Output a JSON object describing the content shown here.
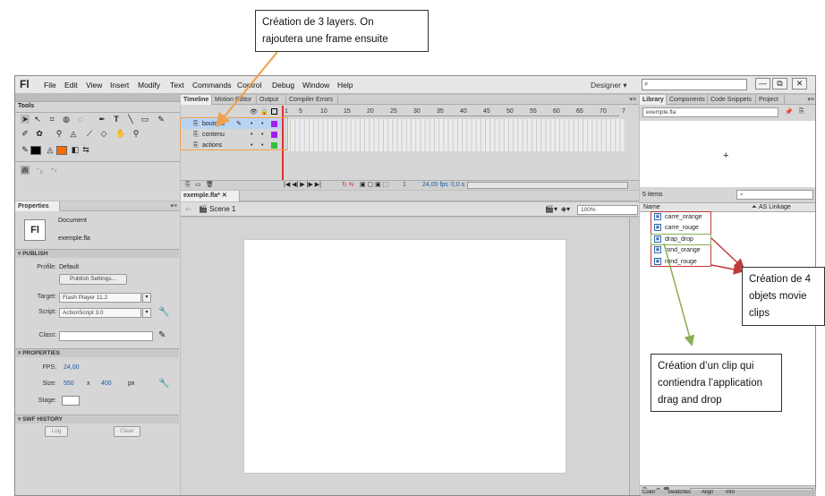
{
  "app": {
    "logo": "Fl",
    "menu": [
      "File",
      "Edit",
      "View",
      "Insert",
      "Modify",
      "Text",
      "Commands",
      "Control",
      "Debug",
      "Window",
      "Help"
    ],
    "workspace": "Designer",
    "search_placeholder": "",
    "win_buttons": [
      "—",
      "⧉",
      "✕"
    ]
  },
  "timeline": {
    "tabs": [
      "Timeline",
      "Motion Editor",
      "Output",
      "Compiler Errors"
    ],
    "ruler": [
      "1",
      "5",
      "10",
      "15",
      "20",
      "25",
      "30",
      "35",
      "40",
      "45",
      "50",
      "55",
      "60",
      "65",
      "70",
      "7"
    ],
    "layers": [
      "boutons",
      "contenu",
      "actions"
    ],
    "fps": "24,00 fps",
    "time": "0,0 s",
    "frame": "1"
  },
  "tools": {
    "title": "Tools"
  },
  "document": {
    "tab": "exemple.fla*",
    "scene": "Scene 1",
    "zoom": "100%"
  },
  "properties": {
    "title": "Properties",
    "doc_type": "Document",
    "doc_name": "exemple.fla",
    "publish_header": "PUBLISH",
    "profile_label": "Profile:",
    "profile_value": "Default",
    "publish_settings": "Publish Settings...",
    "target_label": "Target:",
    "target_value": "Flash Player 11.2",
    "script_label": "Script:",
    "script_value": "ActionScript 3.0",
    "class_label": "Class:",
    "properties_header": "PROPERTIES",
    "fps_label": "FPS:",
    "fps_value": "24,00",
    "size_label": "Size:",
    "width": "550",
    "x": "x",
    "height": "400",
    "px": "px",
    "stage_label": "Stage:",
    "swf_header": "SWF HISTORY",
    "log": "Log",
    "clear": "Clear"
  },
  "library": {
    "tabs": [
      "Library",
      "Components",
      "Code Snippets",
      "Project"
    ],
    "file": "exemple.fla",
    "count": "5 items",
    "col_name": "Name",
    "col_linkage": "AS Linkage",
    "items": [
      "carre_orange",
      "carre_rouge",
      "drap_drop",
      "rond_orange",
      "rond_rouge"
    ],
    "bottom_tabs": [
      "Color",
      "Swatches",
      "Align",
      "Info"
    ]
  },
  "callouts": {
    "layers": [
      "Création de 3 layers. On",
      "rajoutera une frame  ensuite"
    ],
    "movieclips": [
      "Création de 4",
      "objets movie",
      "clips"
    ],
    "dragdrop": [
      "Création d’un clip qui",
      "contiendra l’application",
      "drag and drop"
    ]
  },
  "colors": {
    "annotation_orange": "#f0a04b",
    "annotation_red": "#c0393b",
    "annotation_green": "#8aae54",
    "selected_layer": "#b8d4f5"
  }
}
